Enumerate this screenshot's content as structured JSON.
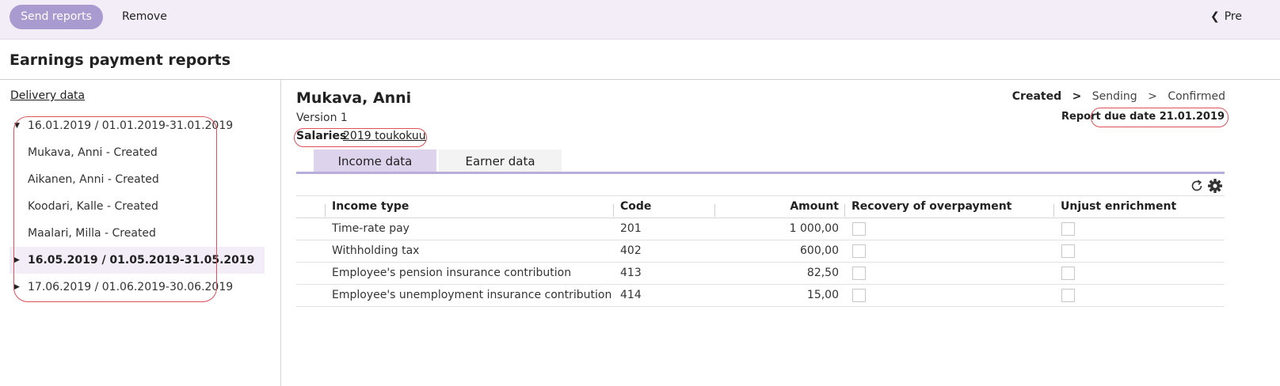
{
  "toolbar": {
    "send_label": "Send reports",
    "remove_label": "Remove",
    "prev_label": "Pre"
  },
  "page": {
    "title": "Earnings payment reports"
  },
  "sidebar": {
    "delivery_label": "Delivery data",
    "groups": [
      {
        "label": "16.01.2019 / 01.01.2019-31.01.2019",
        "expanded": true,
        "children": [
          "Mukava, Anni - Created",
          "Aikanen, Anni - Created",
          "Koodari, Kalle - Created",
          "Maalari, Milla - Created"
        ]
      },
      {
        "label": "16.05.2019 / 01.05.2019-31.05.2019",
        "expanded": false,
        "selected": true
      },
      {
        "label": "17.06.2019 / 01.06.2019-30.06.2019",
        "expanded": false
      }
    ]
  },
  "report": {
    "employee_name": "Mukava, Anni",
    "version": "Version 1",
    "salaries_label": "Salaries",
    "salaries_link": "2019 toukokuu",
    "status": {
      "steps": [
        "Created",
        "Sending",
        "Confirmed"
      ],
      "separator": ">",
      "active_index": 0
    },
    "due_date": "Report due date 21.01.2019",
    "tabs": [
      {
        "label": "Income data",
        "active": true
      },
      {
        "label": "Earner data",
        "active": false
      }
    ],
    "table": {
      "columns": [
        "Income type",
        "Code",
        "Amount",
        "Recovery of overpayment",
        "Unjust enrichment"
      ],
      "rows": [
        {
          "income_type": "Time-rate pay",
          "code": "201",
          "amount": "1 000,00",
          "recovery": false,
          "unjust": false
        },
        {
          "income_type": "Withholding tax",
          "code": "402",
          "amount": "600,00",
          "recovery": false,
          "unjust": false
        },
        {
          "income_type": "Employee's pension insurance contribution",
          "code": "413",
          "amount": "82,50",
          "recovery": false,
          "unjust": false
        },
        {
          "income_type": "Employee's unemployment insurance contribution",
          "code": "414",
          "amount": "15,00",
          "recovery": false,
          "unjust": false
        }
      ]
    }
  },
  "colors": {
    "accent": "#a99bcf",
    "toolbar_bg": "#f3edf8",
    "active_tab": "#ddd3ec",
    "highlight_ring": "#e0505a"
  },
  "icons": {
    "prev": "chevron-left-icon",
    "refresh": "refresh-icon",
    "settings": "gear-icon",
    "tree_expanded": "caret-down-icon",
    "tree_collapsed": "caret-right-icon"
  }
}
